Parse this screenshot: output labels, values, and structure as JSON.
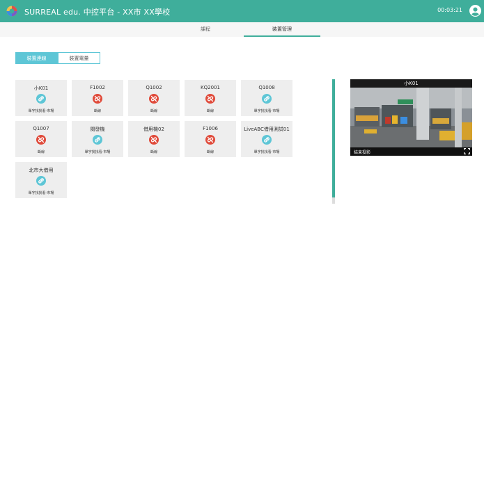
{
  "header": {
    "title": "SURREAL edu. 中控平台 - XX市 XX學校",
    "clock": "00:03:21"
  },
  "tabs": [
    {
      "label": "課程",
      "active": false
    },
    {
      "label": "裝置管理",
      "active": true
    }
  ],
  "subtabs": [
    {
      "label": "裝置連線",
      "active": true
    },
    {
      "label": "裝置電量",
      "active": false
    }
  ],
  "devices": [
    {
      "name": "小K01",
      "status": "單字找找看-市場",
      "connected": true
    },
    {
      "name": "F1002",
      "status": "斷線",
      "connected": false
    },
    {
      "name": "Q1002",
      "status": "斷線",
      "connected": false
    },
    {
      "name": "KQ2001",
      "status": "斷線",
      "connected": false
    },
    {
      "name": "Q1008",
      "status": "單字找找看-市場",
      "connected": true
    },
    {
      "name": "Q1007",
      "status": "斷線",
      "connected": false
    },
    {
      "name": "閱發機",
      "status": "單字找找看-市場",
      "connected": true
    },
    {
      "name": "借用機02",
      "status": "斷線",
      "connected": false
    },
    {
      "name": "F1006",
      "status": "斷線",
      "connected": false
    },
    {
      "name": "LiveABC借用測試01",
      "status": "單字找找看-市場",
      "connected": true
    },
    {
      "name": "北市大借用",
      "status": "單字找找看-市場",
      "connected": true
    }
  ],
  "preview": {
    "device_name": "小K01",
    "end_projection_label": "結束投影"
  },
  "colors": {
    "brand": "#3fae9b",
    "connected": "#5ec6d6",
    "disconnected": "#e04a3a"
  }
}
